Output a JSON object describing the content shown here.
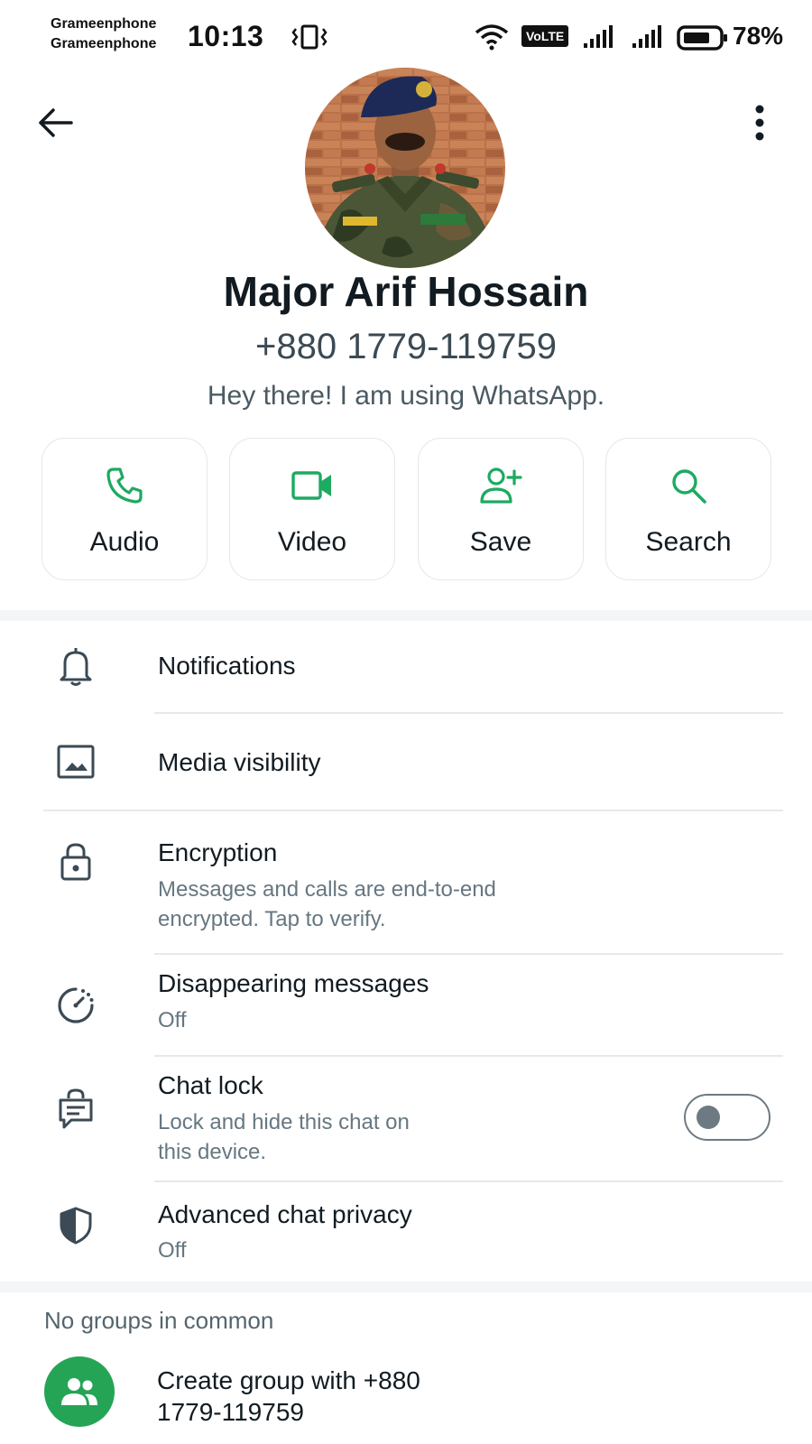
{
  "status_bar": {
    "carrier_1": "Grameenphone",
    "carrier_2": "Grameenphone",
    "time": "10:13",
    "volte": "VoLTE",
    "battery": "78%"
  },
  "header": {
    "back_icon": "arrow-left-icon",
    "menu_icon": "more-vertical-icon"
  },
  "profile": {
    "name": "Major Arif Hossain",
    "phone": "+880 1779-119759",
    "about": "Hey there! I am using WhatsApp."
  },
  "actions": [
    {
      "label": "Audio",
      "icon": "phone-icon"
    },
    {
      "label": "Video",
      "icon": "video-icon"
    },
    {
      "label": "Save",
      "icon": "add-person-icon"
    },
    {
      "label": "Search",
      "icon": "search-icon"
    }
  ],
  "settings": {
    "notifications": {
      "title": "Notifications",
      "icon": "bell-icon"
    },
    "media_visibility": {
      "title": "Media visibility",
      "icon": "image-icon"
    },
    "encryption": {
      "title": "Encryption",
      "sub_1": "Messages and calls are end-to-end",
      "sub_2": "encrypted. Tap to verify.",
      "icon": "lock-icon"
    },
    "disappearing": {
      "title": "Disappearing messages",
      "sub": "Off",
      "icon": "timer-icon"
    },
    "chat_lock": {
      "title": "Chat lock",
      "sub_1": "Lock and hide this chat on",
      "sub_2": "this device.",
      "icon": "chat-lock-icon",
      "enabled": false
    },
    "advanced_privacy": {
      "title": "Advanced chat privacy",
      "sub": "Off",
      "icon": "shield-icon"
    }
  },
  "groups": {
    "label": "No groups in common",
    "create_1": "Create group with +880",
    "create_2": "1779-119759",
    "icon": "group-icon"
  },
  "colors": {
    "accent": "#1daa61",
    "create_circle": "#25a456",
    "text_primary": "#111b21",
    "text_secondary": "#667781"
  }
}
